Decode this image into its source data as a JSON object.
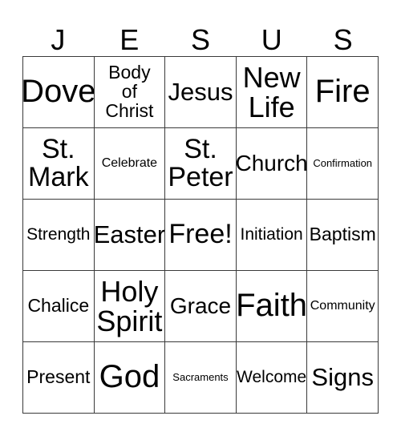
{
  "card": {
    "header_letters": [
      "J",
      "E",
      "S",
      "U",
      "S"
    ],
    "rows": [
      [
        {
          "text": "Dove",
          "size": "fs-xxl"
        },
        {
          "text": "Body\nof\nChrist",
          "size": "fs-s"
        },
        {
          "text": "Jesus",
          "size": "fs-m"
        },
        {
          "text": "New\nLife",
          "size": "fs-xl"
        },
        {
          "text": "Fire",
          "size": "fs-xxl"
        }
      ],
      [
        {
          "text": "St.\nMark",
          "size": "fs-l"
        },
        {
          "text": "Celebrate",
          "size": "fs-xxs"
        },
        {
          "text": "St.\nPeter",
          "size": "fs-l"
        },
        {
          "text": "Church",
          "size": "fs-ml"
        },
        {
          "text": "Confirmation",
          "size": "fs-tiny"
        }
      ],
      [
        {
          "text": "Strength",
          "size": "fs-xs"
        },
        {
          "text": "Easter",
          "size": "fs-m"
        },
        {
          "text": "Free!",
          "size": "fs-l"
        },
        {
          "text": "Initiation",
          "size": "fs-xs"
        },
        {
          "text": "Baptism",
          "size": "fs-s"
        }
      ],
      [
        {
          "text": "Chalice",
          "size": "fs-s"
        },
        {
          "text": "Holy\nSpirit",
          "size": "fs-xl"
        },
        {
          "text": "Grace",
          "size": "fs-ml"
        },
        {
          "text": "Faith",
          "size": "fs-xxl"
        },
        {
          "text": "Community",
          "size": "fs-xxs"
        }
      ],
      [
        {
          "text": "Present",
          "size": "fs-s"
        },
        {
          "text": "God",
          "size": "fs-xxl"
        },
        {
          "text": "Sacraments",
          "size": "fs-tiny"
        },
        {
          "text": "Welcome",
          "size": "fs-xs"
        },
        {
          "text": "Signs",
          "size": "fs-m"
        }
      ]
    ]
  },
  "colors": {
    "border": "#3a3a3a",
    "text": "#000000",
    "background": "#ffffff"
  }
}
